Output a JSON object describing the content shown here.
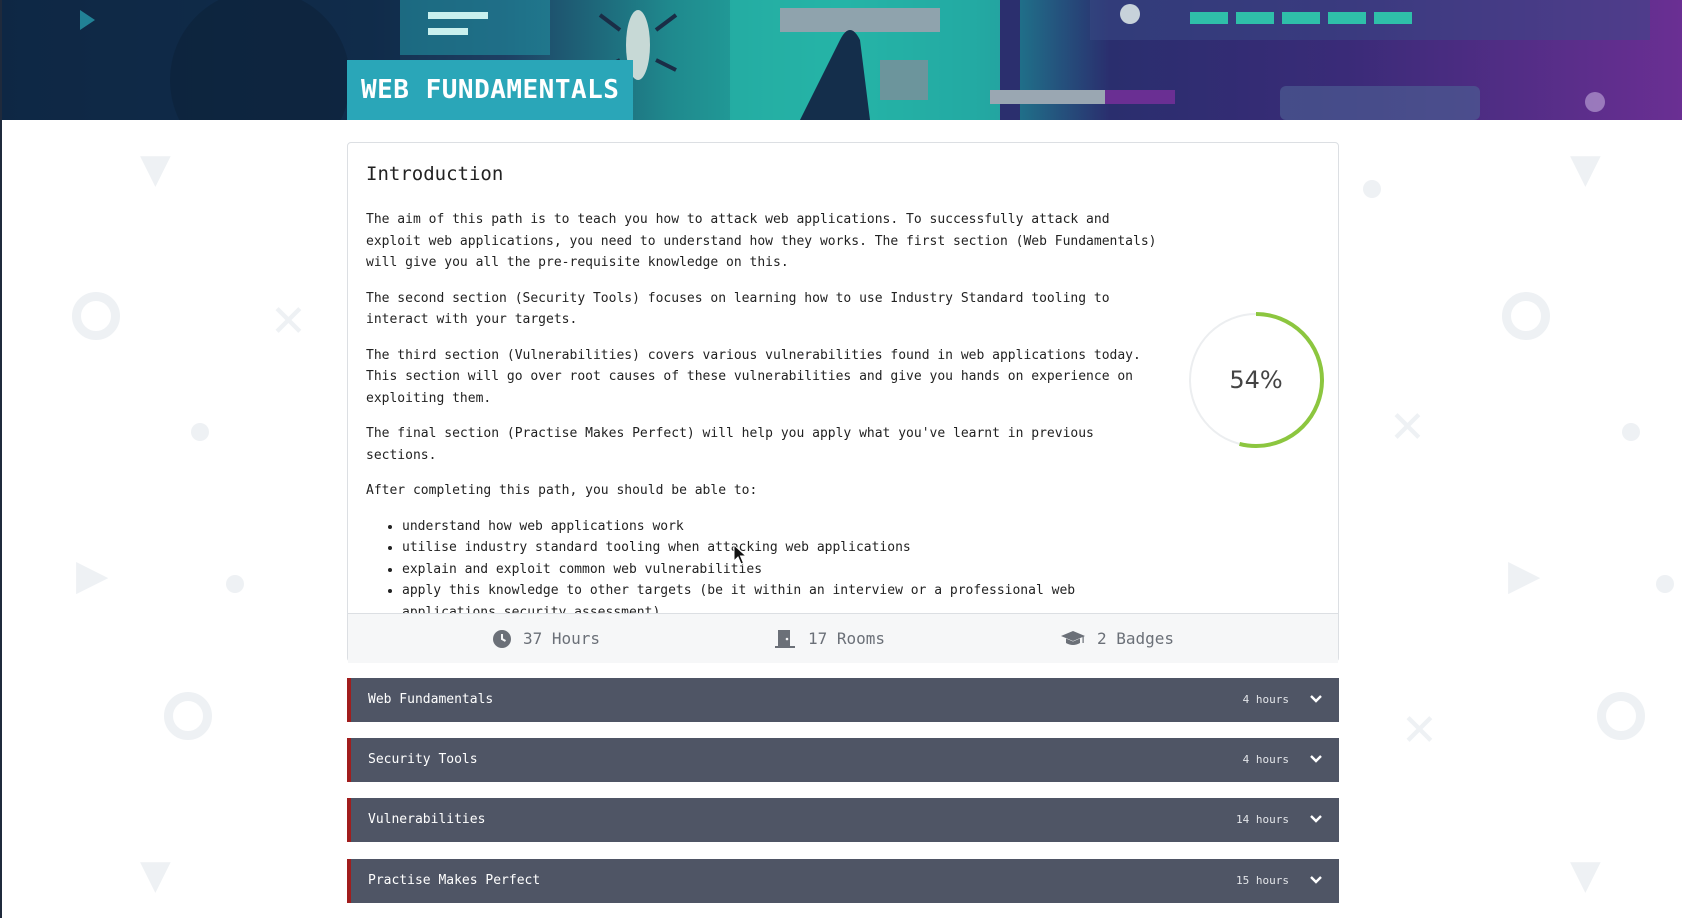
{
  "banner": {
    "title": "WEB FUNDAMENTALS"
  },
  "intro": {
    "heading": "Introduction",
    "paragraphs": [
      "The aim of this path is to teach you how to attack web applications. To successfully attack and exploit web applications, you need to understand how they works. The first section (Web Fundamentals) will give you all the pre-requisite knowledge on this.",
      "The second section (Security Tools) focuses on learning how to use Industry Standard tooling to interact with your targets.",
      "The third section (Vulnerabilities) covers various vulnerabilities found in web applications today. This section will go over root causes of these vulnerabilities and give you hands on experience on exploiting them.",
      "The final section (Practise Makes Perfect) will help you apply what you've learnt in previous sections.",
      "After completing this path, you should be able to:"
    ],
    "bullets": [
      "understand how web applications work",
      "utilise industry standard tooling when attacking web applications",
      "explain and exploit common web vulnerabilities",
      "apply this knowledge to other targets (be it within an interview or a professional web applications security assessment)"
    ]
  },
  "progress": {
    "label": "54%",
    "fraction": 0.54,
    "color": "#8cc63f"
  },
  "stats": {
    "hours": "37 Hours",
    "rooms": "17 Rooms",
    "badges": "2 Badges"
  },
  "sections": [
    {
      "name": "Web Fundamentals",
      "hours": "4 hours"
    },
    {
      "name": "Security Tools",
      "hours": "4 hours"
    },
    {
      "name": "Vulnerabilities",
      "hours": "14 hours"
    },
    {
      "name": "Practise Makes Perfect",
      "hours": "15 hours"
    }
  ],
  "colors": {
    "title_bg": "#2aa6b8",
    "section_bg": "#4f5565",
    "section_accent": "#a11d1d",
    "progress": "#8cc63f"
  },
  "icons": {
    "hours": "clock-icon",
    "rooms": "door-icon",
    "badges": "graduation-cap-icon",
    "section_toggle": "chevron-down-icon"
  }
}
